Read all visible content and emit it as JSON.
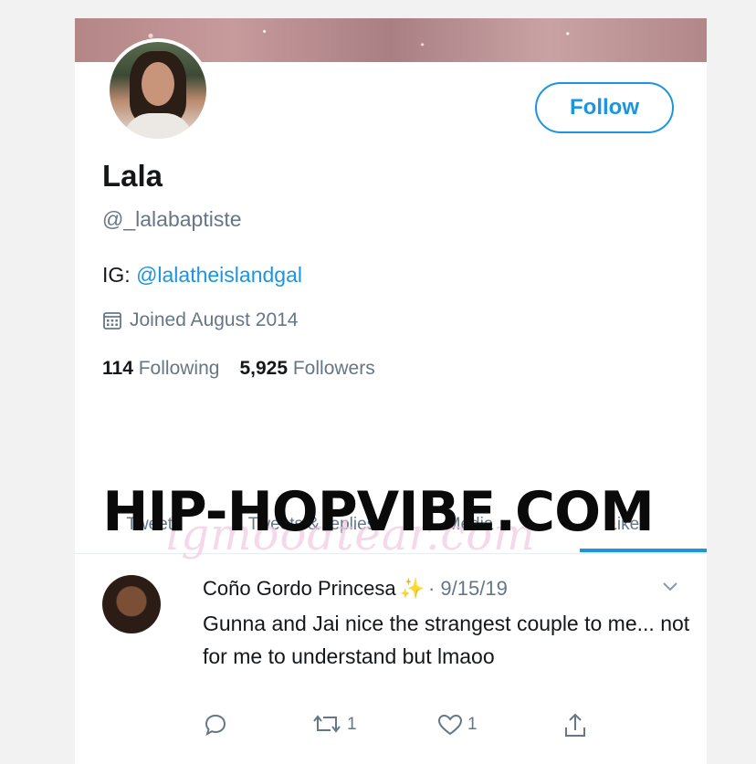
{
  "profile": {
    "display_name": "Lala",
    "handle": "@_lalabaptiste",
    "bio_prefix": "IG: ",
    "bio_link": "@lalatheislandgal",
    "joined": "Joined August 2014",
    "following_count": "114",
    "following_label": "Following",
    "followers_count": "5,925",
    "followers_label": "Followers",
    "follow_button": "Follow"
  },
  "tabs": [
    "Tweets",
    "Tweets & replies",
    "Media",
    "Likes"
  ],
  "tweet": {
    "author": "Coño Gordo Princesa",
    "sparkle": "✨",
    "date": "· 9/15/19",
    "text": "Gunna and Jai nice the strangest couple to me... not for me to understand but lmaoo",
    "retweets": "1",
    "likes": "1"
  },
  "watermark": {
    "overlay": "HIP-HOPVIBE.COM",
    "faint": "lgmoodtear.com"
  },
  "colors": {
    "accent": "#1b95e0",
    "muted": "#657786",
    "text": "#14171a"
  },
  "icons": [
    "calendar-icon",
    "reply-icon",
    "retweet-icon",
    "like-icon",
    "share-icon",
    "chevron-down-icon"
  ]
}
